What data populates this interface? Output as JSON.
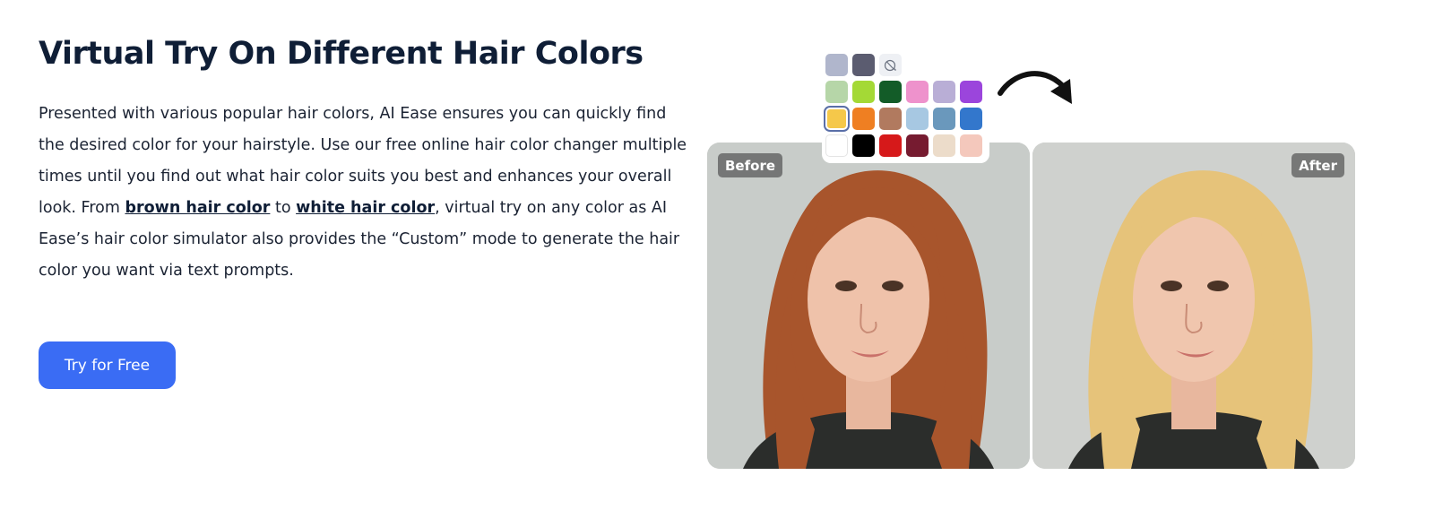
{
  "section": {
    "title": "Virtual Try On Different Hair Colors",
    "description": {
      "part1": "Presented with various popular hair colors, AI Ease ensures you can quickly find the desired color for your hairstyle. Use our free online hair color changer multiple times until you find out what hair color suits you best and enhances your overall look. From ",
      "link1": "brown hair color",
      "part2": " to ",
      "link2": "white hair color",
      "part3": ", virtual try on any color as AI Ease’s hair color simulator also provides the “Custom” mode to generate the hair color you want via text prompts."
    },
    "cta_label": "Try for Free"
  },
  "before_after": {
    "before_label": "Before",
    "after_label": "After",
    "before_hair_color": "#a8552c",
    "after_hair_color": "#e6c37a"
  },
  "palette": {
    "reset_icon": "color-reset-icon",
    "top_row": [
      "#b0b6cc",
      "#5b5c70"
    ],
    "rows": [
      [
        "#b6d6a8",
        "#a4d936",
        "#135c28",
        "#ee92cc",
        "#b9aed6",
        "#9b45dc"
      ],
      [
        "#f5c84a",
        "#ef7f22",
        "#b17a5f",
        "#a7c8e2",
        "#6a98bc",
        "#3377cc"
      ],
      [
        "#ffffff",
        "#000000",
        "#d6191a",
        "#761b30",
        "#ecdcca",
        "#f4c8bc"
      ]
    ],
    "selected_color": "#f5c84a"
  }
}
